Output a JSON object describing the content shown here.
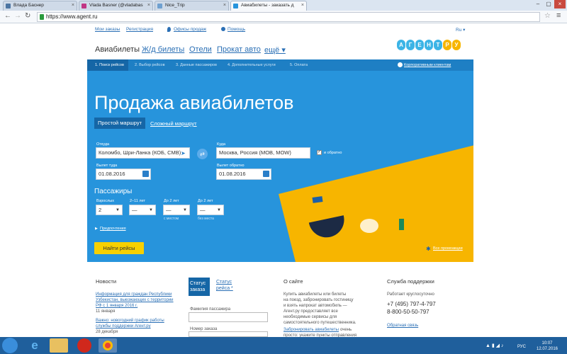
{
  "tabs": [
    {
      "label": "Влада Баснер",
      "fav": "#4c75a3"
    },
    {
      "label": "Vlada Basner (@vladabas",
      "fav": "#c13584"
    },
    {
      "label": "Nice_Trip",
      "fav": "#6fa0d0"
    },
    {
      "label": "Авиабилеты - заказать д",
      "fav": "#2794dc"
    }
  ],
  "browser": {
    "url": "https://www.agent.ru"
  },
  "header": {
    "orders": "Мои заказы",
    "register": "Регистрация",
    "offices": "Офисы продаж",
    "help": "Помощь",
    "lang": "Ru ▾"
  },
  "nav": [
    "Авиабилеты",
    "Ж/д билеты",
    "Отели",
    "Прокат авто",
    "ещё ▾"
  ],
  "logo": [
    "А",
    "Г",
    "Е",
    "Н",
    "Т",
    "Р",
    "У"
  ],
  "steps": [
    "1. Поиск рейсов",
    "2. Выбор рейсов",
    "3. Данные пассажиров",
    "4. Дополнительные услуги",
    "5. Оплата"
  ],
  "corporate": "Корпоративным клиентам",
  "search": {
    "title": "Продажа авиабилетов",
    "route_simple": "Простой маршрут",
    "route_complex": "Сложный маршрут",
    "from_label": "Откуда",
    "from_value": "Коломбо, Шри-Ланка (КОБ, CMB)",
    "to_label": "Куда",
    "to_value": "Москва, Россия (MOB, MOW)",
    "roundtrip_label": "и обратно",
    "depart_label": "Вылет туда",
    "depart_value": "01.08.2016",
    "return_label": "Вылет обратно",
    "return_value": "01.08.2016",
    "passengers": "Пассажиры",
    "adults_label": "Взрослых",
    "adults_value": "2",
    "kids_label": "2–11 лет",
    "kids_value": "—",
    "inf1_label": "До 2 лет",
    "inf1_value": "—",
    "inf1_sub": "с местом",
    "inf2_label": "До 2 лет",
    "inf2_value": "—",
    "inf2_sub": "без места",
    "prefs": "Предпочтения",
    "find": "Найти рейсы",
    "all_promos": "Все промоакции"
  },
  "news": {
    "title": "Новости",
    "items": [
      {
        "text": "Информация для граждан Республики Узбекистан, выезжающих с территории РФ с 1 января 2016 г.",
        "date": "11 января"
      },
      {
        "text": "Важно: новогодний график работы службы поддержки Агент.ру",
        "date": "28 декабря"
      }
    ]
  },
  "status": {
    "tab1a": "Статус",
    "tab1b": "заказа",
    "tab2a": "Статус",
    "tab2b": "рейса *",
    "surname": "Фамилия пассажира",
    "order": "Номер заказа"
  },
  "about": {
    "title": "О сайте",
    "text": [
      "Купить авиабилеты или билеты",
      "на поезд, забронировать гостиницу",
      "и взять напрокат автомобиль —",
      "Агент.ру предоставляет все",
      "необходимые сервисы для",
      "самостоятельного путешественника."
    ],
    "link": "Забронировать авиабилеты",
    "more": "очень",
    "more2": "просто: укажите пункты отправления"
  },
  "support": {
    "title": "Служба поддержки",
    "hours": "Работает круглосуточно",
    "phone1": "+7 (495) 797-4-797",
    "phone2": "8-800-50-50-797",
    "feedback": "Обратная связь"
  },
  "tray": {
    "lang": "РУС",
    "time": "10:07",
    "date": "12.07.2016"
  }
}
